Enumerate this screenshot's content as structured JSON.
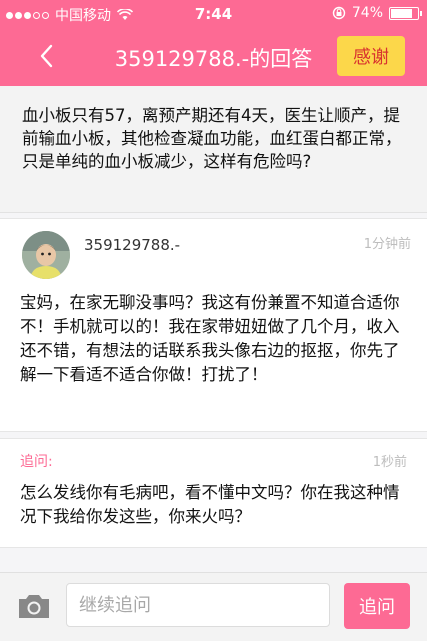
{
  "status_bar": {
    "carrier": "中国移动",
    "time": "7:44",
    "battery": "74%",
    "battery_level": 0.74
  },
  "nav": {
    "title": "359129788.-的回答",
    "thanks_label": "感谢"
  },
  "question": {
    "text": "血小板只有57，离预产期还有4天，医生让顺产，提前输血小板，其他检查凝血功能，血红蛋白都正常，只是单纯的血小板减少，这样有危险吗?"
  },
  "answer": {
    "username": "359129788.-",
    "time": "1分钟前",
    "text": "宝妈，在家无聊没事吗？我这有份兼置不知道合适你不！手机就可以的！我在家带妞妞做了几个月，收入还不错，有想法的话联系我头像右边的抠抠，你先了解一下看适不适合你做！打扰了！"
  },
  "followup": {
    "label": "追问:",
    "time": "1秒前",
    "text": "怎么发线你有毛病吧，看不懂中文吗？你在我这种情况下我给你发这些，你来火吗？"
  },
  "bottom": {
    "placeholder": "继续追问",
    "send_label": "追问"
  },
  "colors": {
    "brand": "#fd6a94",
    "thanks_bg": "#fcd74a",
    "thanks_text": "#d8332f"
  },
  "icons": [
    "signal-dots-icon",
    "wifi-icon",
    "rotation-lock-icon",
    "battery-icon",
    "back-arrow-icon",
    "avatar",
    "camera-icon"
  ]
}
